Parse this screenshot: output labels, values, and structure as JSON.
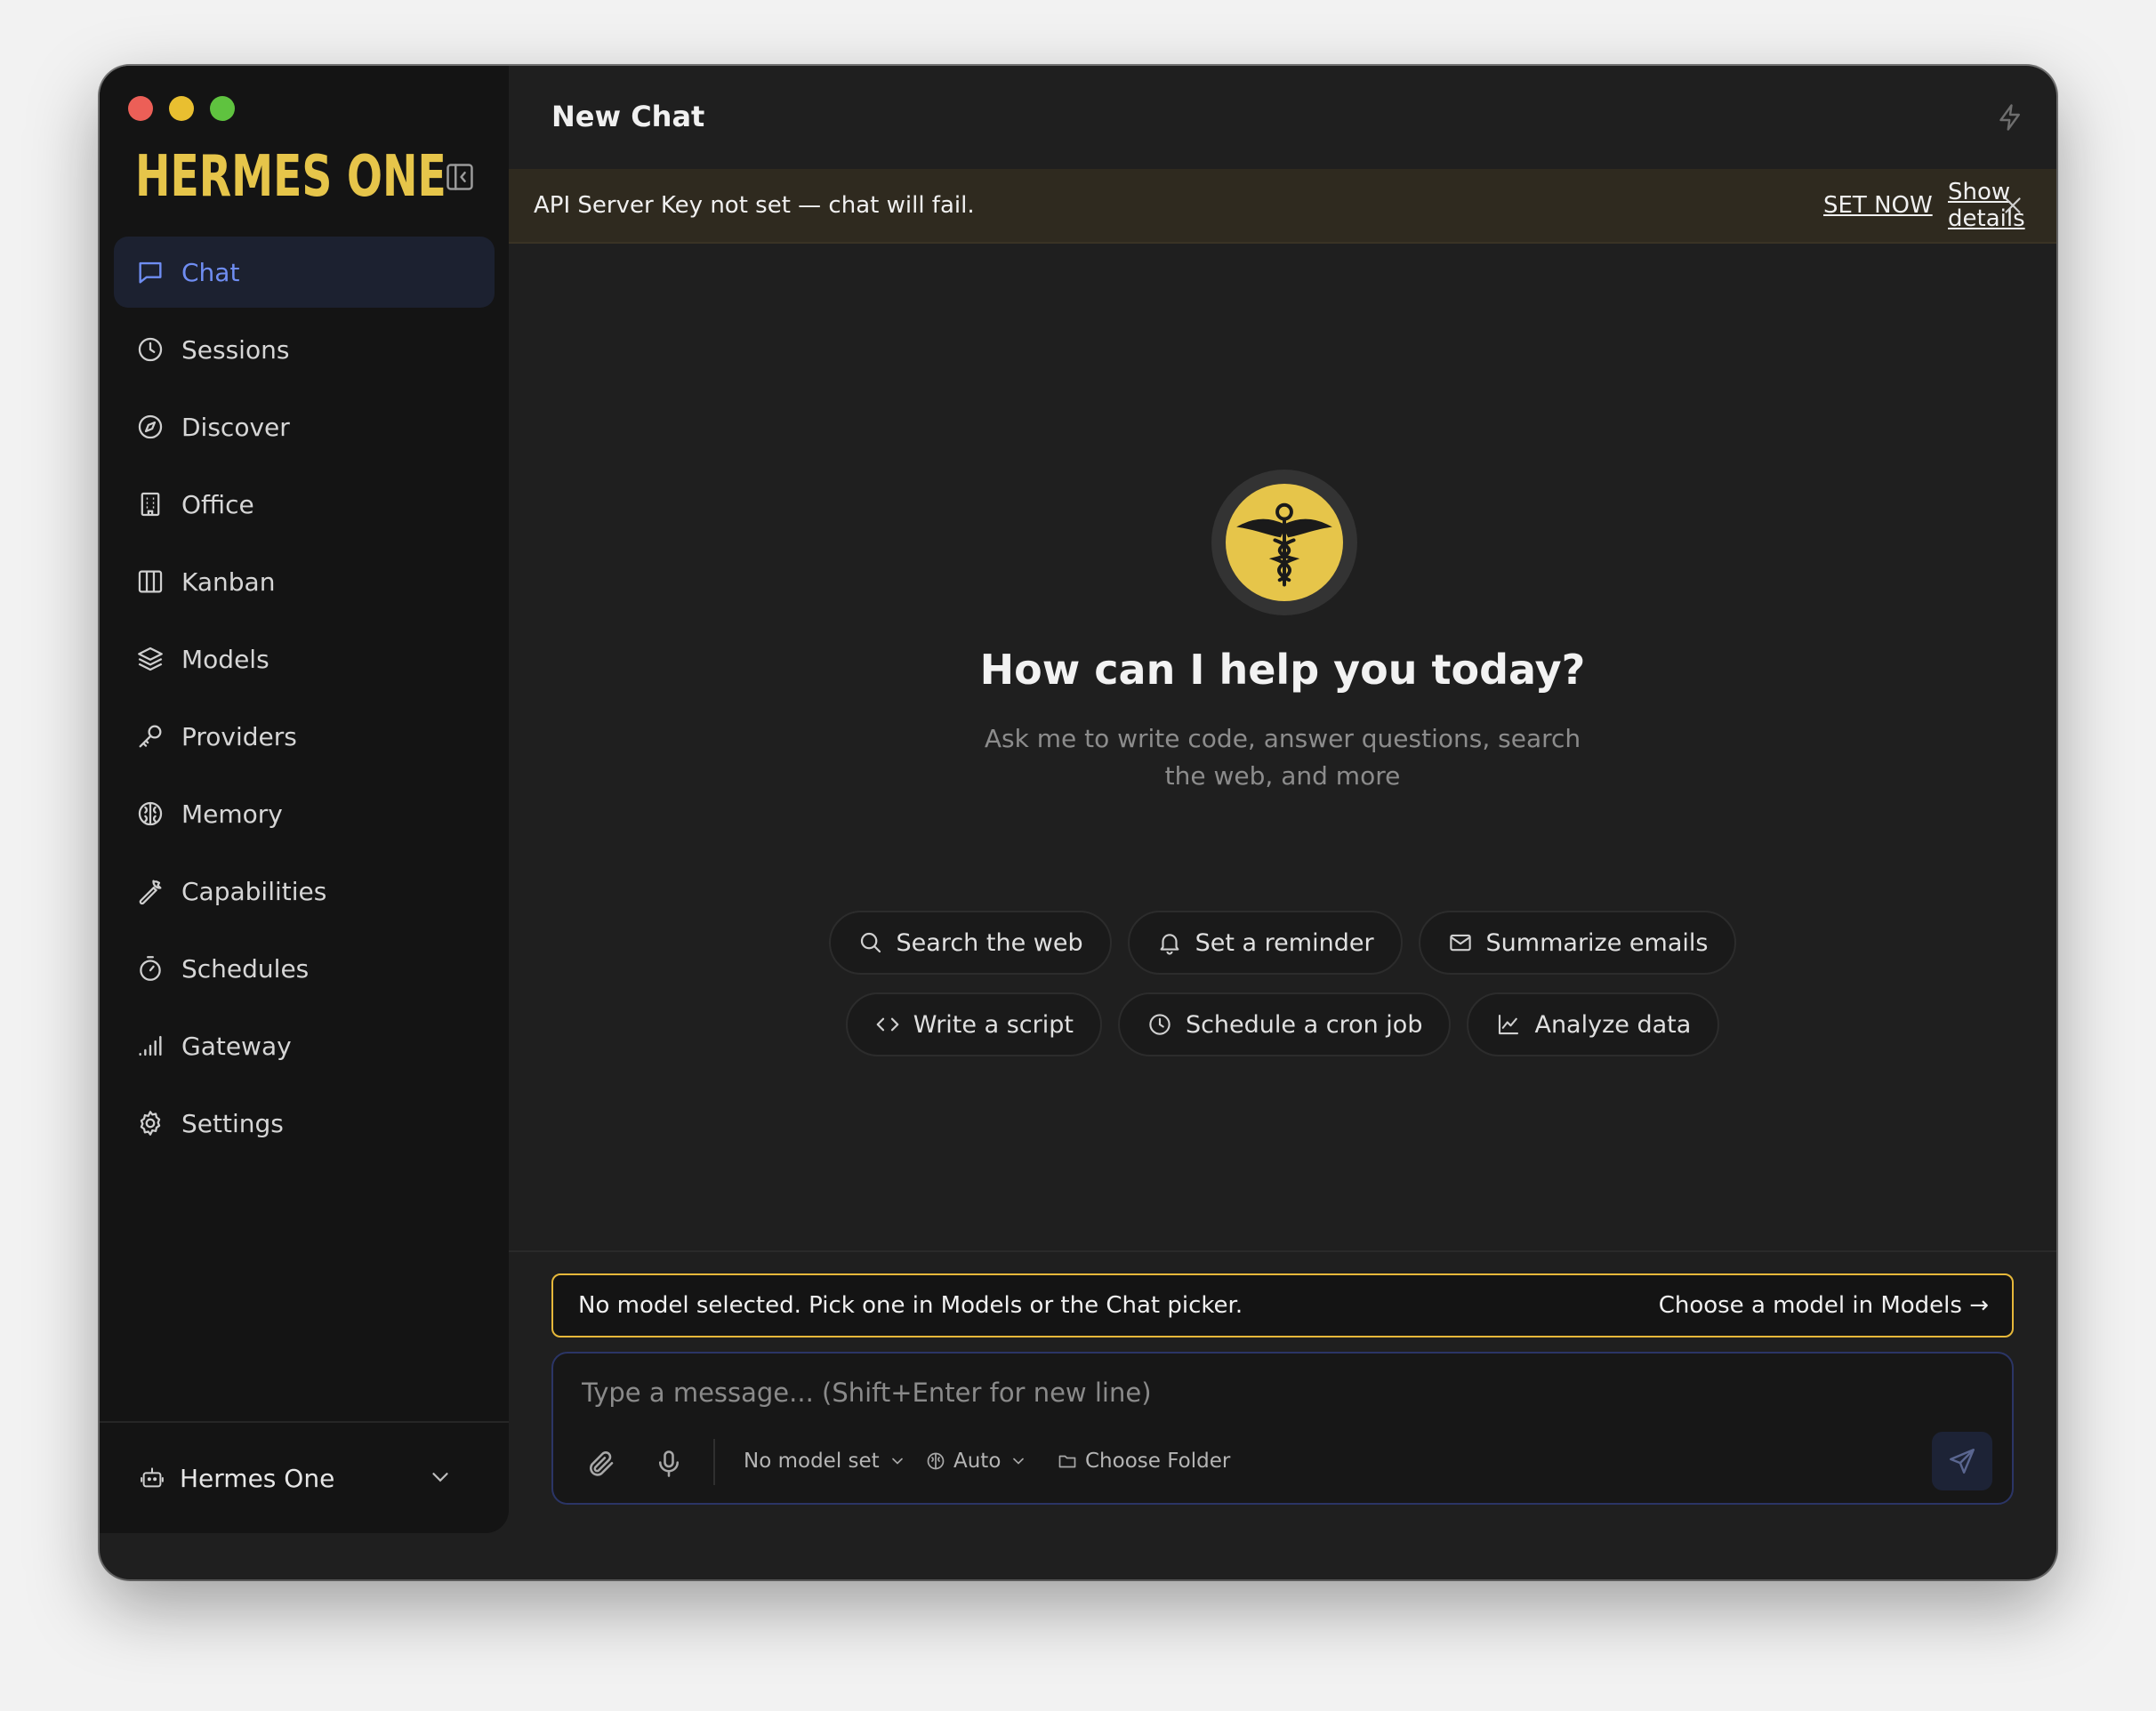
{
  "app": {
    "logo": "HERMES ONE"
  },
  "sidebar": {
    "items": [
      {
        "label": "Chat",
        "icon": "chat-icon"
      },
      {
        "label": "Sessions",
        "icon": "clock-icon"
      },
      {
        "label": "Discover",
        "icon": "compass-icon"
      },
      {
        "label": "Office",
        "icon": "building-icon"
      },
      {
        "label": "Kanban",
        "icon": "columns-icon"
      },
      {
        "label": "Models",
        "icon": "layers-icon"
      },
      {
        "label": "Providers",
        "icon": "key-icon"
      },
      {
        "label": "Memory",
        "icon": "brain-icon"
      },
      {
        "label": "Capabilities",
        "icon": "wrench-icon"
      },
      {
        "label": "Schedules",
        "icon": "timer-icon"
      },
      {
        "label": "Gateway",
        "icon": "signal-icon"
      },
      {
        "label": "Settings",
        "icon": "gear-icon"
      }
    ],
    "active_index": 0,
    "footer": {
      "label": "Hermes One",
      "icon": "bot-icon"
    }
  },
  "header": {
    "title": "New Chat"
  },
  "banner": {
    "message": "API Server Key not set — chat will fail.",
    "set_now": "SET NOW",
    "show_details": "Show details"
  },
  "hero": {
    "headline": "How can I help you today?",
    "subline": "Ask me to write code, answer questions, search the web, and more"
  },
  "suggestions": {
    "row1": [
      "Search the web",
      "Set a reminder",
      "Summarize emails"
    ],
    "row2": [
      "Write a script",
      "Schedule a cron job",
      "Analyze data"
    ]
  },
  "model_warning": {
    "message": "No model selected. Pick one in Models or the Chat picker.",
    "action": "Choose a model in Models →"
  },
  "composer": {
    "placeholder": "Type a message... (Shift+Enter for new line)",
    "model": "No model set",
    "mode": "Auto",
    "folder": "Choose Folder"
  },
  "colors": {
    "accent": "#6f8df2",
    "brand": "#e6c54a",
    "warning": "#e6b83a"
  }
}
